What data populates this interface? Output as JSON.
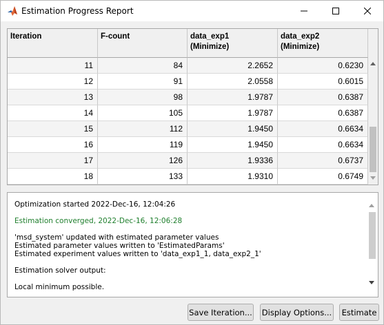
{
  "window": {
    "title": "Estimation Progress Report",
    "icon": "matlab-icon",
    "controls": [
      "minimize-icon",
      "maximize-icon",
      "close-icon"
    ]
  },
  "table": {
    "columns": [
      "Iteration",
      "F-count",
      "data_exp1\n(Minimize)",
      "data_exp2\n(Minimize)"
    ],
    "rows": [
      [
        "11",
        "84",
        "2.2652",
        "0.6230"
      ],
      [
        "12",
        "91",
        "2.0558",
        "0.6015"
      ],
      [
        "13",
        "98",
        "1.9787",
        "0.6387"
      ],
      [
        "14",
        "105",
        "1.9787",
        "0.6387"
      ],
      [
        "15",
        "112",
        "1.9450",
        "0.6634"
      ],
      [
        "16",
        "119",
        "1.9450",
        "0.6634"
      ],
      [
        "17",
        "126",
        "1.9336",
        "0.6737"
      ],
      [
        "18",
        "133",
        "1.9310",
        "0.6749"
      ]
    ]
  },
  "log": {
    "lines": [
      {
        "text": "Optimization started 2022-Dec-16, 12:04:26",
        "style": "normal"
      },
      {
        "text": "",
        "style": "gap"
      },
      {
        "text": "Estimation converged, 2022-Dec-16, 12:06:28",
        "style": "green"
      },
      {
        "text": "",
        "style": "gap"
      },
      {
        "text": "'msd_system' updated with estimated parameter values",
        "style": "normal"
      },
      {
        "text": "Estimated parameter values written to 'EstimatedParams'",
        "style": "normal"
      },
      {
        "text": "Estimated experiment values written to 'data_exp1_1, data_exp2_1'",
        "style": "normal"
      },
      {
        "text": "",
        "style": "gap"
      },
      {
        "text": "Estimation solver output:",
        "style": "normal"
      },
      {
        "text": "",
        "style": "gap"
      },
      {
        "text": "Local minimum possible.",
        "style": "normal"
      }
    ]
  },
  "buttons": {
    "save_iteration": "Save Iteration...",
    "display_options": "Display Options...",
    "estimate": "Estimate"
  },
  "colors": {
    "converged_text": "#1f7f2d",
    "matlab_icon": "#e16737"
  }
}
